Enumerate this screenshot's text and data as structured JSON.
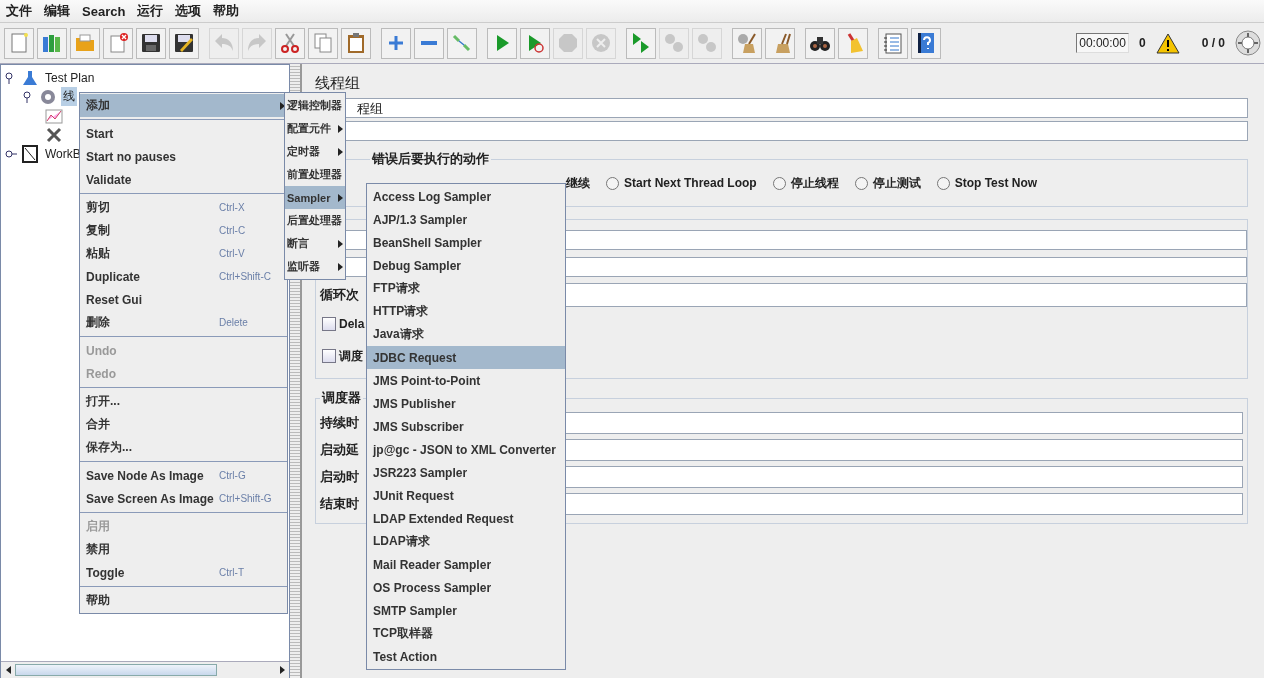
{
  "menu_bar": [
    "文件",
    "编辑",
    "Search",
    "运行",
    "选项",
    "帮助"
  ],
  "toolbar": {
    "groups": [
      {
        "buttons": [
          {
            "disabled": false
          },
          {
            "disabled": false
          },
          {
            "disabled": false
          },
          {
            "disabled": false
          },
          {
            "disabled": false
          },
          {
            "disabled": false
          }
        ]
      },
      {
        "buttons": [
          {
            "disabled": true
          },
          {
            "disabled": true
          },
          {
            "disabled": false
          },
          {
            "disabled": false
          },
          {
            "disabled": false
          }
        ]
      },
      {
        "buttons": [
          {
            "disabled": false
          },
          {
            "disabled": false
          },
          {
            "disabled": false
          }
        ]
      },
      {
        "buttons": [
          {
            "disabled": false
          },
          {
            "disabled": false
          },
          {
            "disabled": true
          },
          {
            "disabled": true
          }
        ]
      },
      {
        "buttons": [
          {
            "disabled": false
          },
          {
            "disabled": true
          },
          {
            "disabled": true
          }
        ]
      },
      {
        "buttons": [
          {
            "disabled": false
          },
          {
            "disabled": false
          }
        ]
      },
      {
        "buttons": [
          {
            "disabled": false
          },
          {
            "disabled": false
          }
        ]
      },
      {
        "buttons": [
          {
            "disabled": false
          },
          {
            "disabled": false
          }
        ]
      }
    ],
    "timer": "00:00:00",
    "error_count": "0",
    "thread_count": "0 / 0"
  },
  "tree": [
    {
      "label": "Test Plan",
      "expanded": true,
      "children": [
        {
          "label": "线",
          "selected": true,
          "expanded": true,
          "children": [
            {
              "selected": false
            },
            {
              "selected": false
            }
          ]
        }
      ]
    },
    {
      "label": "WorkB",
      "expanded": false
    }
  ],
  "context_menu": {
    "sections": [
      [
        {
          "label": "添加",
          "selected": true,
          "submenu": true
        }
      ],
      [
        {
          "label": "Start"
        },
        {
          "label": "Start no pauses"
        },
        {
          "label": "Validate"
        }
      ],
      [
        {
          "label": "剪切",
          "shortcut": "Ctrl-X"
        },
        {
          "label": "复制",
          "shortcut": "Ctrl-C"
        },
        {
          "label": "粘贴",
          "shortcut": "Ctrl-V"
        },
        {
          "label": "Duplicate",
          "shortcut": "Ctrl+Shift-C"
        },
        {
          "label": "Reset Gui"
        },
        {
          "label": "删除",
          "shortcut": "Delete"
        }
      ],
      [
        {
          "label": "Undo",
          "disabled": true
        },
        {
          "label": "Redo",
          "disabled": true
        }
      ],
      [
        {
          "label": "打开..."
        },
        {
          "label": "合并"
        },
        {
          "label": "保存为..."
        }
      ],
      [
        {
          "label": "Save Node As Image",
          "shortcut": "Ctrl-G"
        },
        {
          "label": "Save Screen As Image",
          "shortcut": "Ctrl+Shift-G"
        }
      ],
      [
        {
          "label": "启用",
          "disabled": true
        },
        {
          "label": "禁用"
        },
        {
          "label": "Toggle",
          "shortcut": "Ctrl-T"
        }
      ],
      [
        {
          "label": "帮助"
        }
      ]
    ]
  },
  "add_submenu": [
    {
      "label": "逻辑控制器",
      "selected": false
    },
    {
      "label": "配置元件",
      "selected": false
    },
    {
      "label": "定时器",
      "selected": false
    },
    {
      "label": "前置处理器",
      "selected": false
    },
    {
      "label": "Sampler",
      "selected": true
    },
    {
      "label": "后置处理器",
      "selected": false
    },
    {
      "label": "断言",
      "selected": false
    },
    {
      "label": "监听器",
      "selected": false
    }
  ],
  "sampler_submenu": [
    {
      "label": "Access Log Sampler",
      "selected": false
    },
    {
      "label": "AJP/1.3 Sampler",
      "selected": false
    },
    {
      "label": "BeanShell Sampler",
      "selected": false
    },
    {
      "label": "Debug Sampler",
      "selected": false
    },
    {
      "label": "FTP请求",
      "selected": false
    },
    {
      "label": "HTTP请求",
      "selected": false
    },
    {
      "label": "Java请求",
      "selected": false
    },
    {
      "label": "JDBC Request",
      "selected": true
    },
    {
      "label": "JMS Point-to-Point",
      "selected": false
    },
    {
      "label": "JMS Publisher",
      "selected": false
    },
    {
      "label": "JMS Subscriber",
      "selected": false
    },
    {
      "label": "jp@gc - JSON to XML Converter",
      "selected": false
    },
    {
      "label": "JSR223 Sampler",
      "selected": false
    },
    {
      "label": "JUnit Request",
      "selected": false
    },
    {
      "label": "LDAP Extended Request",
      "selected": false
    },
    {
      "label": "LDAP请求",
      "selected": false
    },
    {
      "label": "Mail Reader Sampler",
      "selected": false
    },
    {
      "label": "OS Process Sampler",
      "selected": false
    },
    {
      "label": "SMTP Sampler",
      "selected": false
    },
    {
      "label": "TCP取样器",
      "selected": false
    },
    {
      "label": "Test Action",
      "selected": false
    }
  ],
  "panel": {
    "title": "线程组",
    "name_value": "程组",
    "on_error": {
      "legend": "错误后要执行的动作",
      "cut_label": "继续",
      "options": [
        {
          "label": "Start Next Thread Loop",
          "selected": false
        },
        {
          "label": "停止线程",
          "selected": false
        },
        {
          "label": "停止测试",
          "selected": false
        },
        {
          "label": "Stop Test Now",
          "selected": false
        }
      ]
    },
    "thread_properties": {
      "loop_label": "循环次",
      "checkboxes": [
        {
          "label": "Dela",
          "checked": false
        },
        {
          "label": "调度",
          "checked": false
        }
      ]
    },
    "scheduler": {
      "legend": "调度器",
      "fields": [
        {
          "label": "持续时"
        },
        {
          "label": "启动延"
        },
        {
          "label": "启动时"
        },
        {
          "label": "结束时"
        }
      ]
    }
  }
}
